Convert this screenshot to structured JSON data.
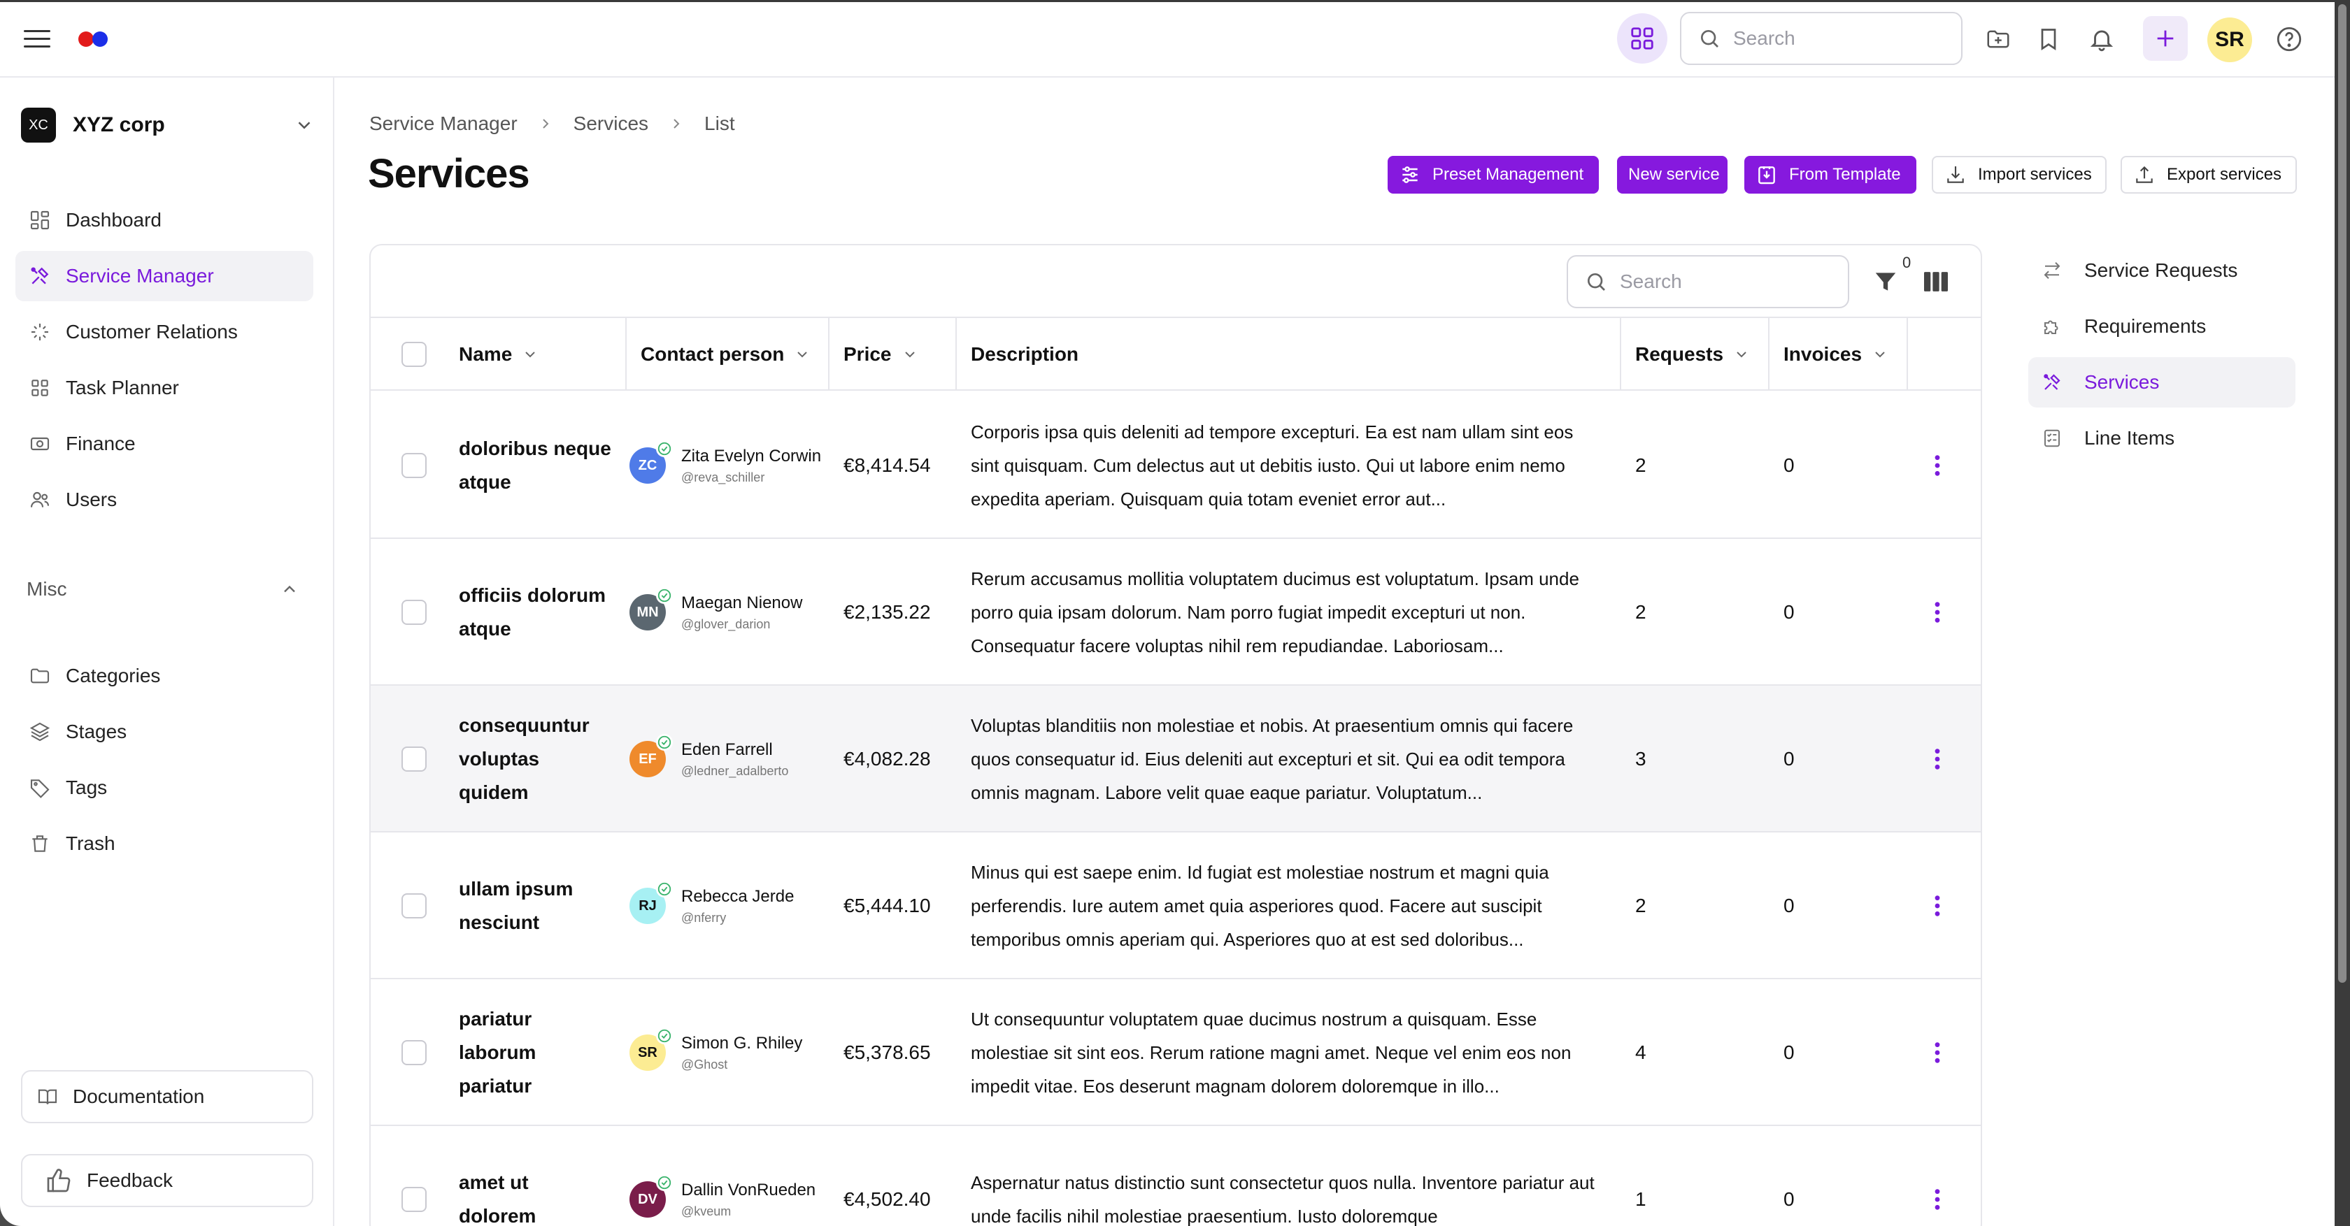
{
  "topbar": {
    "search_placeholder": "Search",
    "user_initials": "SR"
  },
  "sidebar": {
    "org_initials": "XC",
    "org_name": "XYZ corp",
    "items": [
      {
        "label": "Dashboard",
        "icon": "dashboard-icon"
      },
      {
        "label": "Service Manager",
        "icon": "tools-icon"
      },
      {
        "label": "Customer Relations",
        "icon": "sparkles-icon"
      },
      {
        "label": "Task Planner",
        "icon": "grid-icon"
      },
      {
        "label": "Finance",
        "icon": "money-icon"
      },
      {
        "label": "Users",
        "icon": "users-icon"
      }
    ],
    "misc_label": "Misc",
    "misc_items": [
      {
        "label": "Categories",
        "icon": "folder-icon"
      },
      {
        "label": "Stages",
        "icon": "layers-icon"
      },
      {
        "label": "Tags",
        "icon": "tag-icon"
      },
      {
        "label": "Trash",
        "icon": "trash-icon"
      }
    ],
    "documentation_label": "Documentation",
    "feedback_label": "Feedback"
  },
  "breadcrumb": [
    "Service Manager",
    "Services",
    "List"
  ],
  "page_title": "Services",
  "actions": {
    "preset_management": "Preset Management",
    "new_service": "New service",
    "from_template": "From Template",
    "import_services": "Import services",
    "export_services": "Export services"
  },
  "table": {
    "search_placeholder": "Search",
    "filter_count": "0",
    "columns": {
      "name": "Name",
      "contact_person": "Contact person",
      "price": "Price",
      "description": "Description",
      "requests": "Requests",
      "invoices": "Invoices"
    },
    "rows": [
      {
        "name_lines": [
          "doloribus neque",
          "atque"
        ],
        "initials": "ZC",
        "avatar_color": "#4f7be8",
        "contact": "Zita Evelyn Corwin",
        "handle": "@reva_schiller",
        "price": "€8,414.54",
        "description": "Corporis ipsa quis deleniti ad tempore excepturi. Ea est nam ullam sint eos sint quisquam. Cum delectus aut ut debitis iusto. Qui ut labore enim nemo expedita aperiam. Quisquam quia totam eveniet error aut...",
        "requests": "2",
        "invoices": "0"
      },
      {
        "name_lines": [
          "officiis dolorum",
          "atque"
        ],
        "initials": "MN",
        "avatar_color": "#5b6770",
        "contact": "Maegan Nienow",
        "handle": "@glover_darion",
        "price": "€2,135.22",
        "description": "Rerum accusamus mollitia voluptatem ducimus est voluptatum. Ipsam unde porro quia ipsam dolorum. Nam porro fugiat impedit excepturi ut non. Consequatur facere voluptas nihil rem repudiandae. Laboriosam...",
        "requests": "2",
        "invoices": "0"
      },
      {
        "name_lines": [
          "consequuntur",
          "voluptas",
          "quidem"
        ],
        "initials": "EF",
        "avatar_color": "#ef8a2c",
        "contact": "Eden Farrell",
        "handle": "@ledner_adalberto",
        "price": "€4,082.28",
        "description": "Voluptas blanditiis non molestiae et nobis. At praesentium omnis qui facere quos consequatur id. Eius deleniti aut excepturi et sit. Qui ea odit tempora omnis magnam. Labore velit quae eaque pariatur. Voluptatum...",
        "requests": "3",
        "invoices": "0"
      },
      {
        "name_lines": [
          "ullam ipsum",
          "nesciunt"
        ],
        "initials": "RJ",
        "avatar_color": "#a7f0f3",
        "contact": "Rebecca Jerde",
        "handle": "@nferry",
        "price": "€5,444.10",
        "description": "Minus qui est saepe enim. Id fugiat est molestiae nostrum et magni quia perferendis. Iure autem amet quia asperiores quod. Facere aut suscipit temporibus omnis aperiam qui. Asperiores quo at est sed doloribus...",
        "requests": "2",
        "invoices": "0"
      },
      {
        "name_lines": [
          "pariatur",
          "laborum",
          "pariatur"
        ],
        "initials": "SR",
        "avatar_color": "#fcec93",
        "contact": "Simon G. Rhiley",
        "handle": "@Ghost",
        "price": "€5,378.65",
        "description": "Ut consequuntur voluptatem quae ducimus nostrum a quisquam. Esse molestiae sit sint eos. Rerum ratione magni amet. Neque vel enim eos non impedit vitae. Eos deserunt magnam dolorem doloremque in illo...",
        "requests": "4",
        "invoices": "0"
      },
      {
        "name_lines": [
          "amet ut",
          "dolorem"
        ],
        "initials": "DV",
        "avatar_color": "#7a1d4a",
        "contact": "Dallin VonRueden",
        "handle": "@kveum",
        "price": "€4,502.40",
        "description": "Aspernatur natus distinctio sunt consectetur quos nulla. Inventore pariatur aut unde facilis nihil molestiae praesentium. Iusto doloremque",
        "requests": "1",
        "invoices": "0"
      }
    ]
  },
  "subnav": [
    {
      "label": "Service Requests",
      "icon": "arrows-exchange-icon"
    },
    {
      "label": "Requirements",
      "icon": "puzzle-icon"
    },
    {
      "label": "Services",
      "icon": "tools-icon"
    },
    {
      "label": "Line Items",
      "icon": "list-check-icon"
    }
  ],
  "colors": {
    "accent": "#8619de",
    "active_text": "#7a1bdc",
    "active_bg": "#f2f2f5"
  }
}
